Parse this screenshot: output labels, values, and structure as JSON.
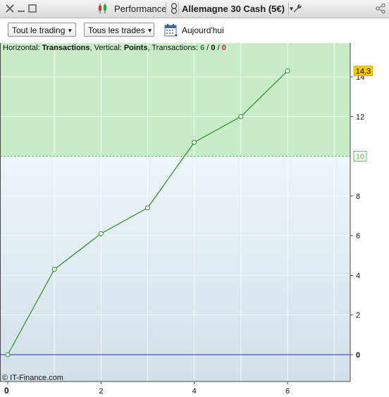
{
  "window": {
    "performance_label": "Performance",
    "instrument_label": "Allemagne 30 Cash (5€)"
  },
  "toolbar": {
    "filter_trading": "Tout le trading",
    "filter_trades": "Tous les trades",
    "date_label": "Aujourd'hui"
  },
  "info": {
    "horizontal_label": "Horizontal:",
    "horizontal_value": "Transactions",
    "vertical_label": "Vertical:",
    "vertical_value": "Points",
    "transactions_label": "Transactions:",
    "count_total": "6",
    "count_mid": "0",
    "count_neg": "0",
    "sep": "/"
  },
  "copyright": "© IT-Finance.com",
  "colors": {
    "positive_zone": "#c8ecc8",
    "lower_zone_top": "#eef4f8",
    "lower_zone_bottom": "#d2e0e7",
    "line": "#2a8a2a",
    "zero_line": "#2233cc",
    "threshold_label": "#5cb85c",
    "last_value_badge": "#f6c600",
    "count_total_color": "#2a8a2a",
    "count_neg_color": "#cc2222"
  },
  "chart_data": {
    "type": "line",
    "x": [
      0,
      1,
      2,
      3,
      4,
      5,
      6
    ],
    "y": [
      0,
      4.3,
      6.1,
      7.4,
      10.7,
      12.0,
      14.3
    ],
    "xlim": [
      0,
      7.35
    ],
    "ylim": [
      -1.35,
      15.4
    ],
    "xticks": [
      0,
      2,
      4,
      6
    ],
    "yticks": [
      0,
      2,
      4,
      6,
      8,
      10,
      12,
      14
    ],
    "threshold": 10,
    "threshold_label": "10",
    "last_value_label": "14,3",
    "grid": true,
    "xlabel": "",
    "ylabel": ""
  }
}
